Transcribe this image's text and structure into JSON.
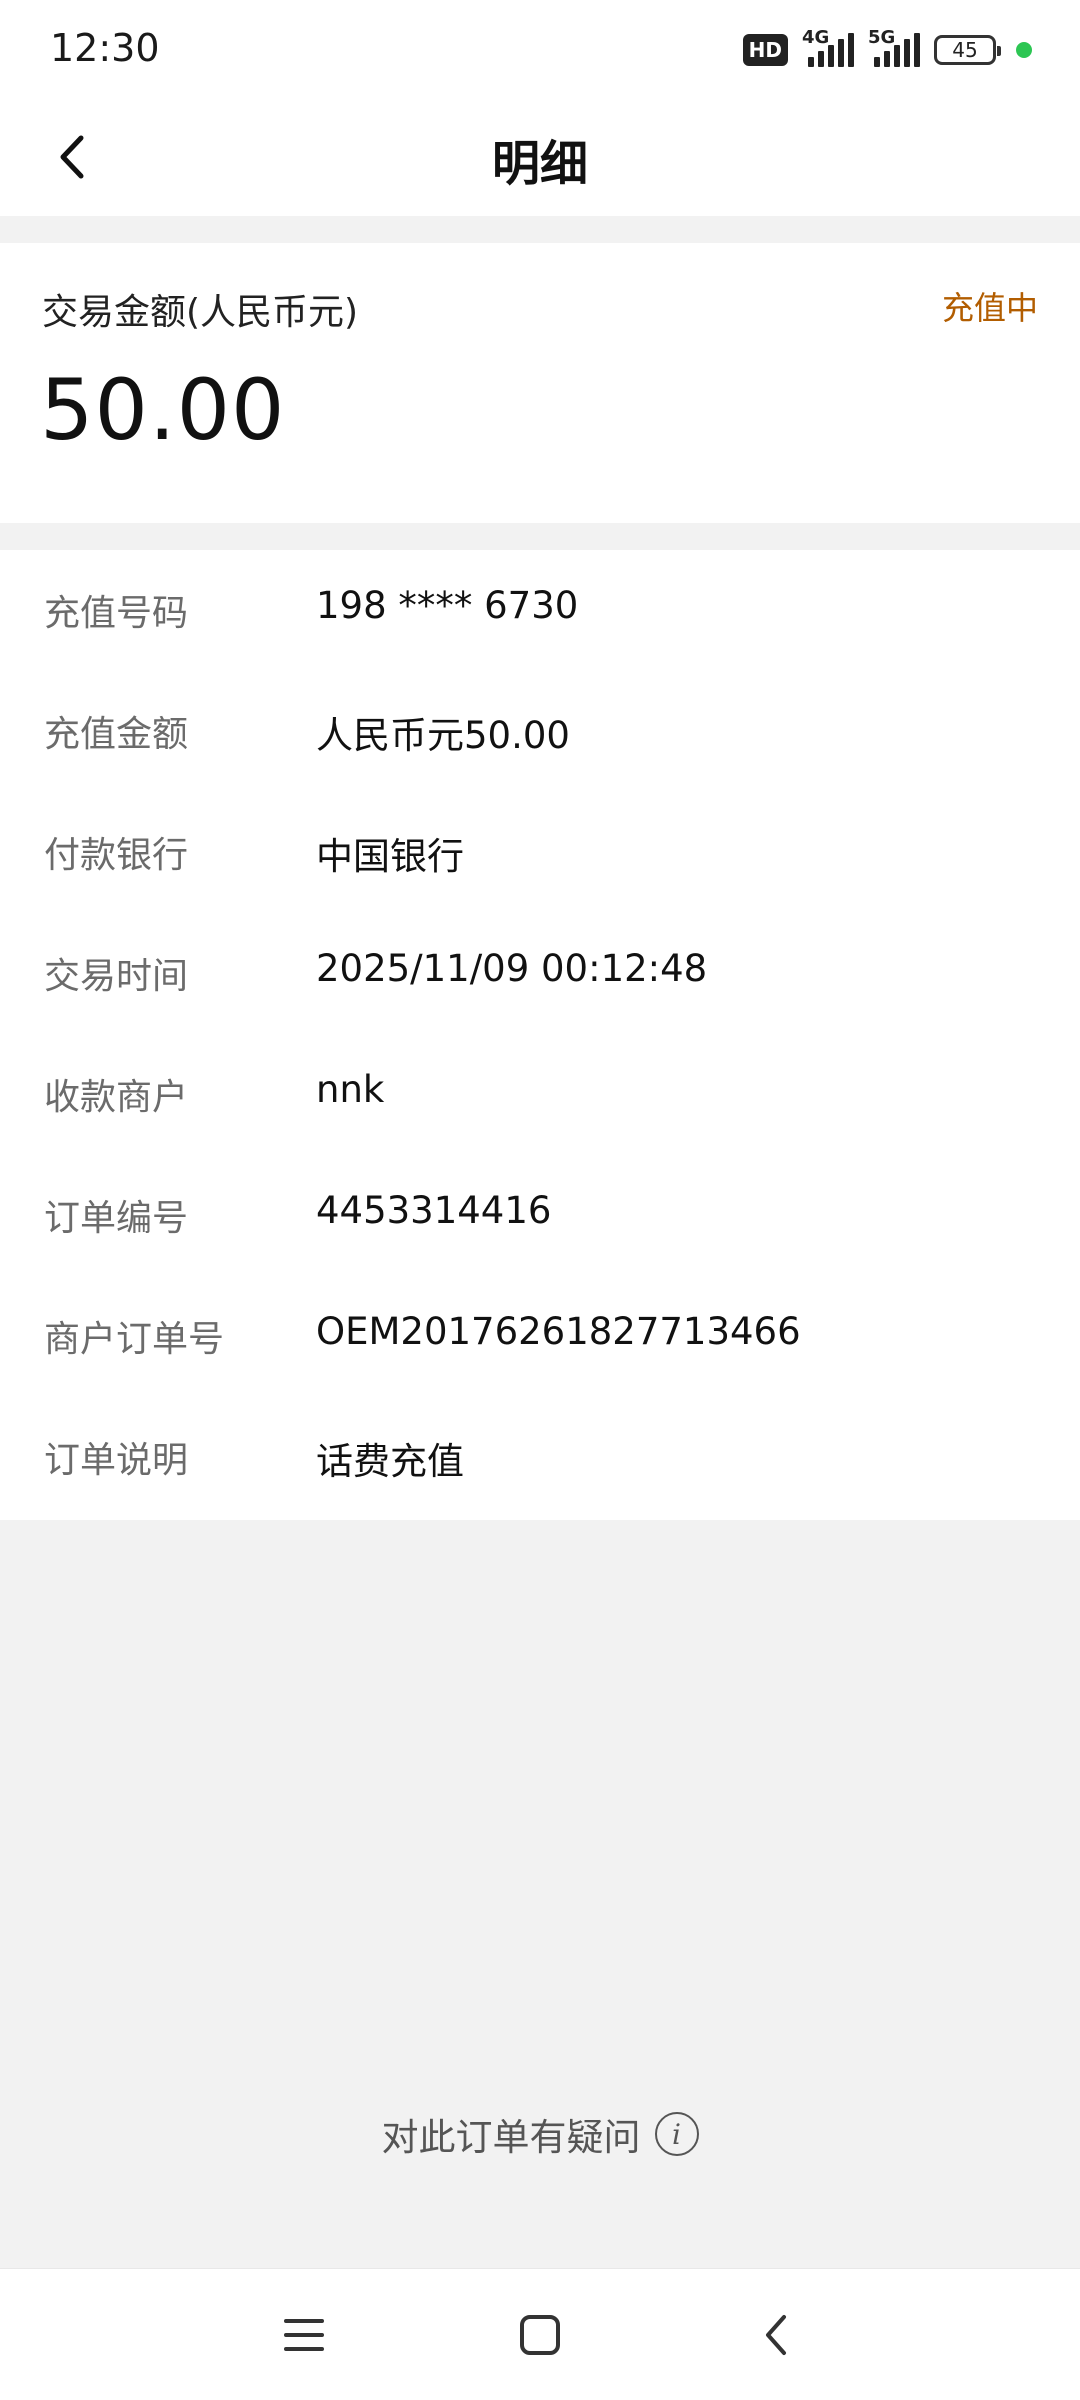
{
  "status_bar": {
    "time": "12:30",
    "hd_badge": "HD",
    "signal_1_label": "4G",
    "signal_2_label": "5G",
    "battery": "45"
  },
  "header": {
    "title": "明细",
    "back_icon": "chevron-left-icon"
  },
  "amount": {
    "label": "交易金额(人民币元)",
    "status": "充值中",
    "status_color": "#b25d00",
    "value": "50.00"
  },
  "details": [
    {
      "label": "充值号码",
      "value": "198 **** 6730"
    },
    {
      "label": "充值金额",
      "value": "人民币元50.00"
    },
    {
      "label": "付款银行",
      "value": "中国银行"
    },
    {
      "label": "交易时间",
      "value": "2025/11/09 00:12:48"
    },
    {
      "label": "收款商户",
      "value": "nnk"
    },
    {
      "label": "订单编号",
      "value": "4453314416"
    },
    {
      "label": "商户订单号",
      "value": "OEM20176261827713466"
    },
    {
      "label": "订单说明",
      "value": "话费充值"
    }
  ],
  "help": {
    "text": "对此订单有疑问",
    "icon": "info-icon",
    "icon_glyph": "i"
  },
  "nav_bar": {
    "menu_icon": "menu-icon",
    "home_icon": "home-icon",
    "back_icon": "back-icon"
  }
}
